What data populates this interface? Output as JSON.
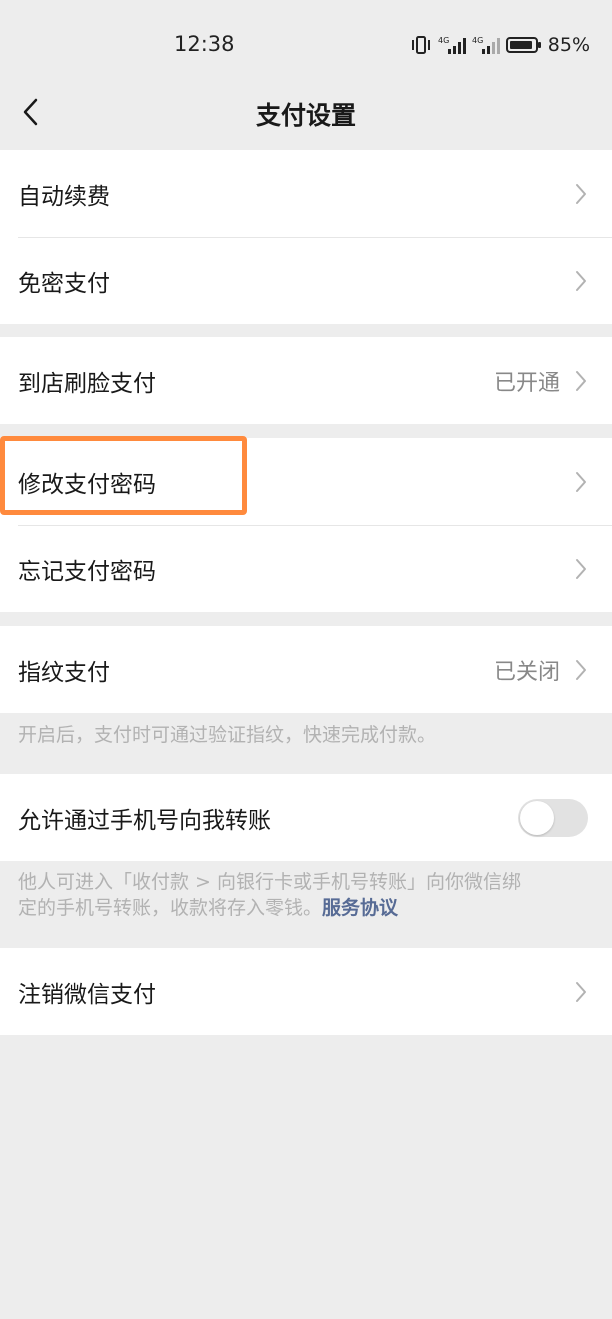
{
  "status_bar": {
    "time": "12:38",
    "signal1": "4G",
    "signal2": "4G",
    "battery": "85%",
    "icons": [
      "vibrate-icon",
      "signal-icon",
      "battery-icon"
    ]
  },
  "header": {
    "title": "支付设置",
    "back_icon": "chevron-left-icon"
  },
  "groups": {
    "g1": {
      "items": [
        {
          "label": "自动续费"
        },
        {
          "label": "免密支付"
        }
      ]
    },
    "g2": {
      "items": [
        {
          "label": "到店刷脸支付",
          "value": "已开通"
        }
      ]
    },
    "g3": {
      "items": [
        {
          "label": "修改支付密码"
        },
        {
          "label": "忘记支付密码"
        }
      ]
    },
    "g4": {
      "items": [
        {
          "label": "指纹支付",
          "value": "已关闭"
        }
      ],
      "description": "开启后，支付时可通过验证指纹，快速完成付款。"
    },
    "g5": {
      "items": [
        {
          "label": "允许通过手机号向我转账",
          "toggle_on": false
        }
      ],
      "description_line1": "他人可进入「收付款 > 向银行卡或手机号转账」向你微信绑",
      "description_line2": "定的手机号转账，收款将存入零钱。",
      "link": "服务协议"
    },
    "g6": {
      "items": [
        {
          "label": "注销微信支付"
        }
      ]
    }
  },
  "colors": {
    "background": "#ededed",
    "highlight": "#ff8a3d",
    "link": "#576b95",
    "secondary_text": "#888888"
  }
}
